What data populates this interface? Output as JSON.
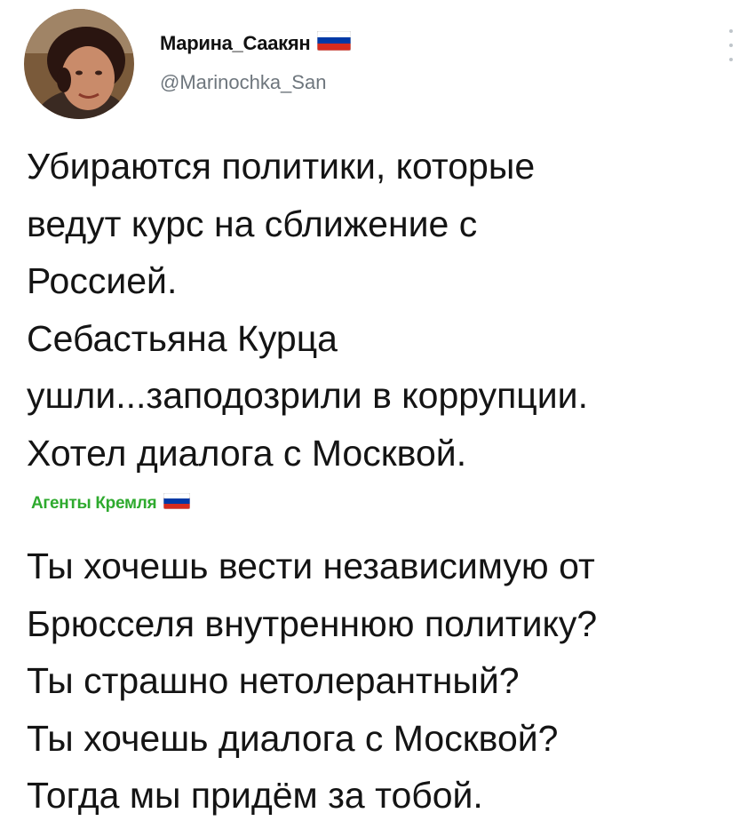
{
  "author": {
    "name": "Марина_Саакян",
    "handle": "@Marinochka_San",
    "avatar_icon": "profile-photo",
    "flag_icon": "flag-icon",
    "flag_colors": [
      "#ffffff",
      "#0039a6",
      "#d52b1e"
    ]
  },
  "menu_icon": "more-vertical-icon",
  "tweet": {
    "lines": [
      "Убираются политики, которые",
      "ведут курс на сближение с",
      "Россией.",
      "Себастьяна Курца",
      "ушли...заподозрили в коррупции.",
      "Хотел диалога с Москвой."
    ]
  },
  "quote": {
    "label": "Агенты Кремля",
    "label_color": "#2eaa2e",
    "lines": [
      "Ты хочешь вести независимую от",
      "Брюсселя внутреннюю политику?",
      "Ты страшно нетолерантный?",
      "Ты хочешь диалога с Москвой?",
      "Тогда мы придём за тобой."
    ]
  }
}
